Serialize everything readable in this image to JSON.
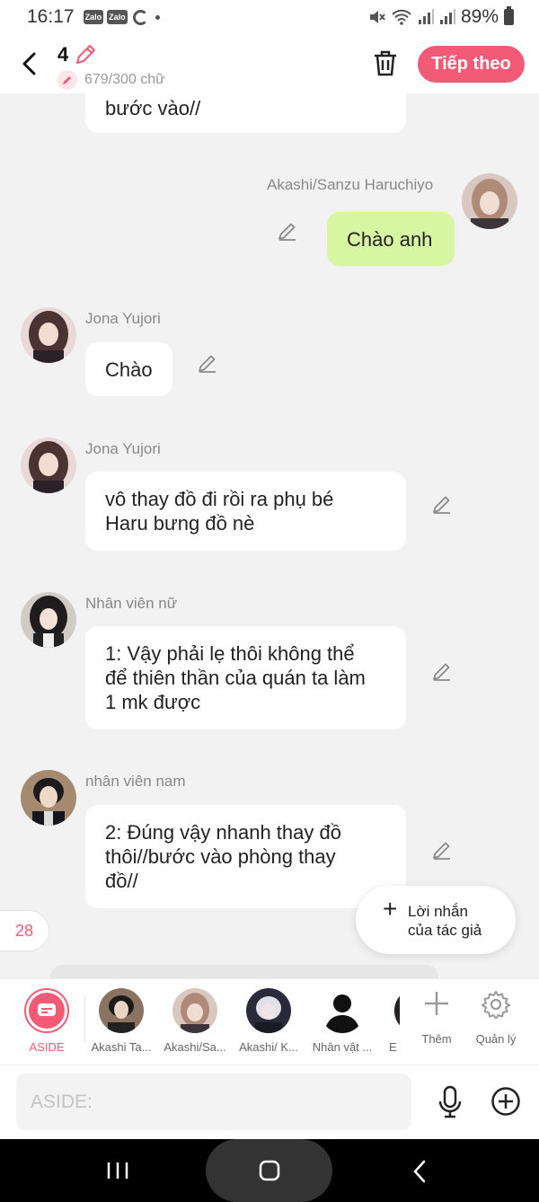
{
  "status_bar": {
    "time": "16:17",
    "app_badges": [
      "Zalo",
      "Zalo"
    ],
    "battery": "89%"
  },
  "header": {
    "episode_number": "4",
    "word_count": "679/300 chữ",
    "next_button": "Tiếp theo"
  },
  "messages": [
    {
      "speaker": "",
      "text": "bước vào//",
      "side": "left"
    },
    {
      "speaker": "Akashi/Sanzu Haruchiyo",
      "text": "Chào anh",
      "side": "right"
    },
    {
      "speaker": "Jona Yujori",
      "text": "Chào",
      "side": "left"
    },
    {
      "speaker": "Jona Yujori",
      "lines": [
        "vô thay đồ đi rồi ra phụ bé",
        "Haru bưng đồ nè"
      ],
      "side": "left"
    },
    {
      "speaker": "Nhân viên nữ",
      "lines": [
        "1: Vậy phải lẹ thôi không thể",
        "để thiên thần của quán ta làm",
        "1 mk được"
      ],
      "side": "left"
    },
    {
      "speaker": "nhân viên nam",
      "lines": [
        "2: Đúng vậy nhanh thay đồ",
        "thôi//bước vào phòng thay",
        "đồ//"
      ],
      "side": "left"
    }
  ],
  "count_badge": "28",
  "author_note": {
    "plus": "+",
    "label_lines": [
      "Lời nhắn",
      "của tác giả"
    ]
  },
  "characters": [
    {
      "label": "ASIDE"
    },
    {
      "label": "Akashi Ta..."
    },
    {
      "label": "Akashi/Sa..."
    },
    {
      "label": "Akashi/ K..."
    },
    {
      "label": "Nhân vật ..."
    },
    {
      "label": "E"
    }
  ],
  "tools": {
    "add_label": "Thêm",
    "manage_label": "Quản lý"
  },
  "input": {
    "placeholder": "ASIDE:"
  },
  "colors": {
    "accent": "#f35a75",
    "own_bubble": "#d8f5a2",
    "background": "#f2f2f2"
  }
}
